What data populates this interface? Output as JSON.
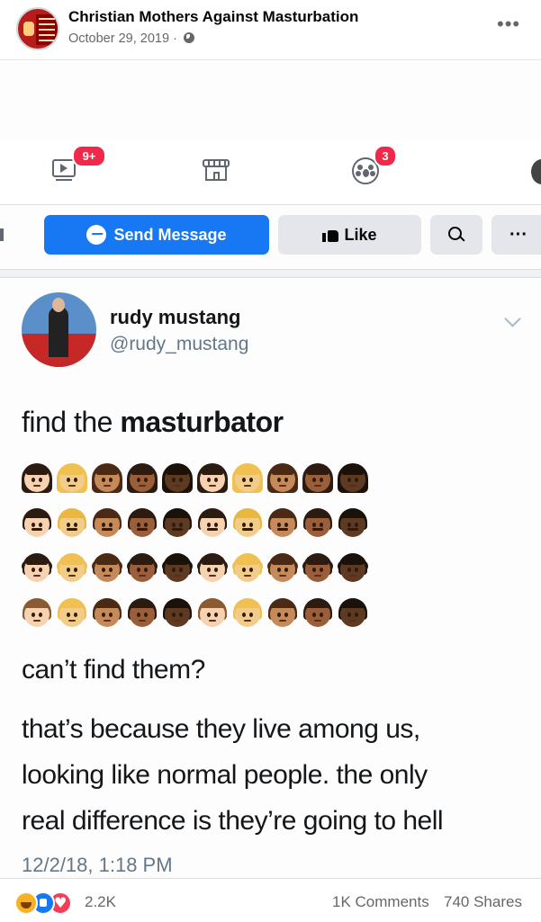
{
  "post": {
    "page_name": "Christian Mothers Against Masturbation",
    "date": "October 29, 2019",
    "separator": "·",
    "audience_icon": "globe-icon",
    "more_icon": "more-horizontal-icon"
  },
  "screenshot": {
    "nav": {
      "video_badge": "9+",
      "groups_badge": "3",
      "icons": [
        "watch-video-icon",
        "marketplace-store-icon",
        "groups-icon"
      ]
    },
    "buttons": {
      "send_message": "Send Message",
      "like": "Like",
      "search_icon": "search-icon",
      "more": "···"
    },
    "tweet": {
      "name": "rudy mustang",
      "handle": "@rudy_mustang",
      "line1_prefix": "find the ",
      "line1_bold": "masturbator",
      "question": "can’t find them?",
      "body_lines": [
        "that’s because they live among us,",
        "looking like normal people. the only",
        "real difference is they’re going to hell"
      ],
      "timestamp": "12/2/18, 1:18 PM",
      "emoji_rows": [
        {
          "kind": "woman",
          "skins": [
            "#f6d2b0",
            "#f2cd8a",
            "#c68a5a",
            "#9a5f3a",
            "#5e3a23",
            "#f6d2b0",
            "#f2cd8a",
            "#c68a5a",
            "#9a5f3a",
            "#5e3a23"
          ],
          "hair": [
            "#2b1b10",
            "#f0c050",
            "#4a2a14",
            "#2b1b10",
            "#1a110a",
            "#2b1b10",
            "#f0c050",
            "#4a2a14",
            "#2b1b10",
            "#1a110a"
          ]
        },
        {
          "kind": "man",
          "skins": [
            "#f6d2b0",
            "#f2cd8a",
            "#c68a5a",
            "#9a5f3a",
            "#5e3a23",
            "#f6d2b0",
            "#f2cd8a",
            "#c68a5a",
            "#9a5f3a",
            "#5e3a23"
          ],
          "hair": [
            "#2b1b10",
            "#e8b840",
            "#4a2a14",
            "#2b1b10",
            "#1a110a",
            "#2b1b10",
            "#e8b840",
            "#4a2a14",
            "#2b1b10",
            "#1a110a"
          ]
        },
        {
          "kind": "girl",
          "skins": [
            "#f6d2b0",
            "#f2cd8a",
            "#c68a5a",
            "#9a5f3a",
            "#5e3a23",
            "#f6d2b0",
            "#f2cd8a",
            "#c68a5a",
            "#9a5f3a",
            "#5e3a23"
          ],
          "hair": [
            "#2b1b10",
            "#f0c050",
            "#4a2a14",
            "#2b1b10",
            "#1a110a",
            "#2b1b10",
            "#f0c050",
            "#4a2a14",
            "#2b1b10",
            "#1a110a"
          ]
        },
        {
          "kind": "boy",
          "skins": [
            "#f6d2b0",
            "#f2cd8a",
            "#c68a5a",
            "#9a5f3a",
            "#5e3a23",
            "#f6d2b0",
            "#f2cd8a",
            "#c68a5a",
            "#9a5f3a",
            "#5e3a23"
          ],
          "hair": [
            "#8a5a30",
            "#f0c050",
            "#4a2a14",
            "#2b1b10",
            "#1a110a",
            "#8a5a30",
            "#f0c050",
            "#4a2a14",
            "#2b1b10",
            "#1a110a"
          ]
        }
      ]
    }
  },
  "engagement": {
    "reaction_icons": [
      "haha-icon",
      "like-icon",
      "love-icon"
    ],
    "reaction_count": "2.2K",
    "comments": "1K Comments",
    "shares": "740 Shares"
  },
  "colors": {
    "facebook_blue": "#1877f2",
    "badge_red": "#f02849",
    "secondary_text": "#65676b"
  }
}
